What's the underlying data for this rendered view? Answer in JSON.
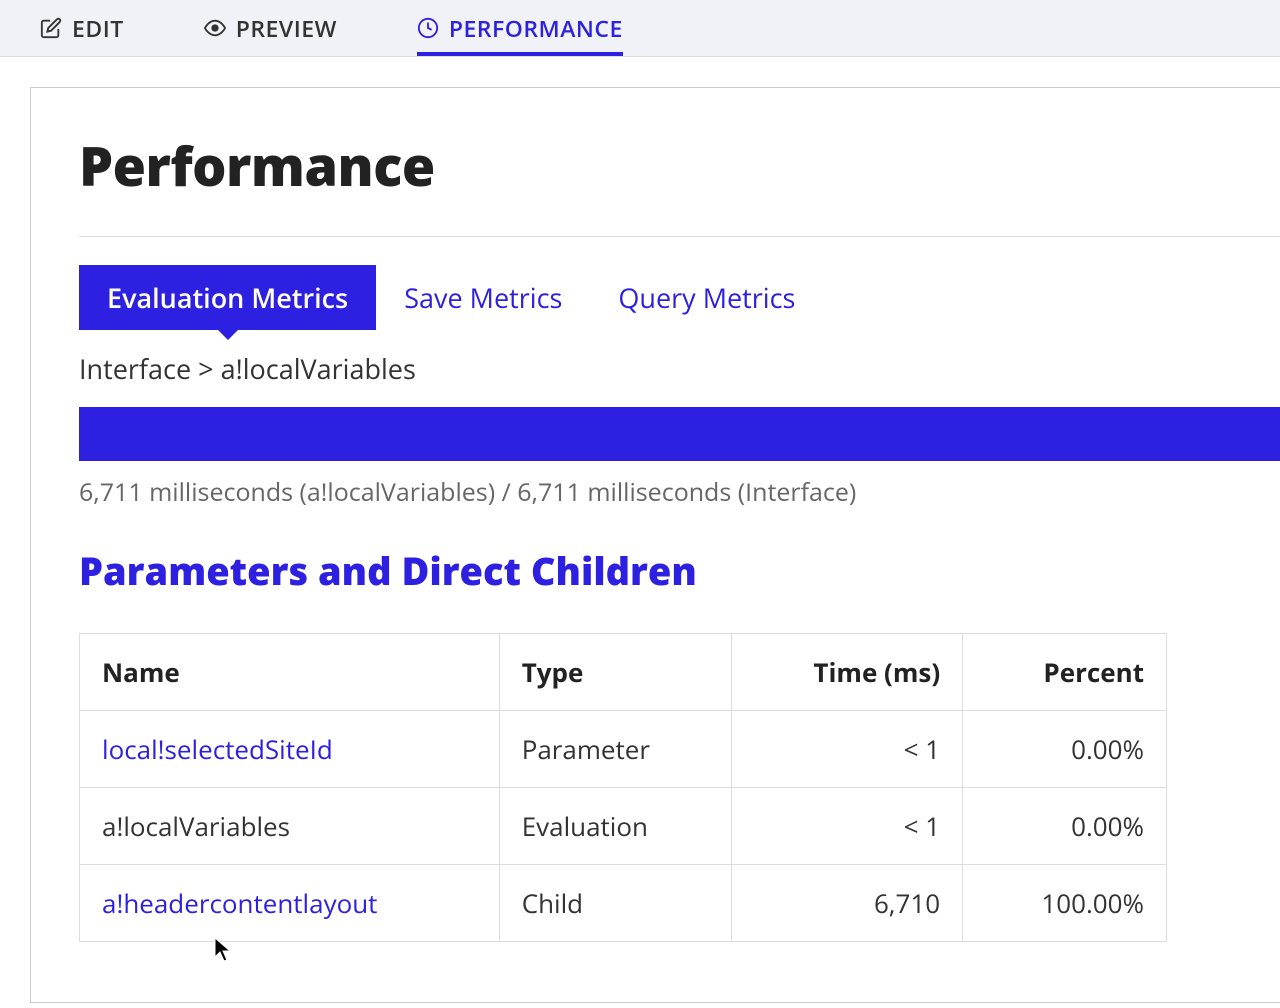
{
  "topTabs": {
    "edit": "EDIT",
    "preview": "PREVIEW",
    "performance": "PERFORMANCE"
  },
  "pageTitle": "Performance",
  "metricTabs": {
    "evaluation": "Evaluation Metrics",
    "save": "Save Metrics",
    "query": "Query Metrics"
  },
  "breadcrumb": "Interface > a!localVariables",
  "progressText": "6,711 milliseconds (a!localVariables) / 6,711 milliseconds (Interface)",
  "sectionTitle": "Parameters and Direct Children",
  "table": {
    "headers": {
      "name": "Name",
      "type": "Type",
      "time": "Time (ms)",
      "percent": "Percent"
    },
    "rows": [
      {
        "name": "local!selectedSiteId",
        "type": "Parameter",
        "time": "< 1",
        "percent": "0.00%",
        "link": true
      },
      {
        "name": "a!localVariables",
        "type": "Evaluation",
        "time": "< 1",
        "percent": "0.00%",
        "link": false
      },
      {
        "name": "a!headercontentlayout",
        "type": "Child",
        "time": "6,710",
        "percent": "100.00%",
        "link": true
      }
    ]
  }
}
